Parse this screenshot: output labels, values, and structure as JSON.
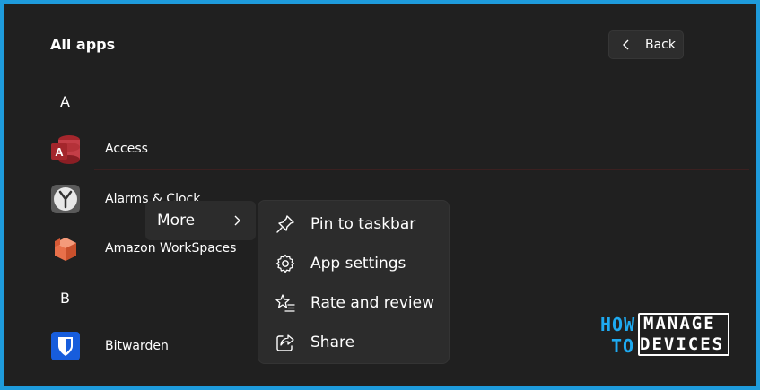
{
  "header": {
    "title": "All apps",
    "back_label": "Back"
  },
  "sections": [
    {
      "letter": "A",
      "apps": [
        {
          "name": "Access",
          "icon": "access-icon"
        },
        {
          "name": "Alarms & Clock",
          "icon": "alarms-clock-icon"
        },
        {
          "name": "Amazon WorkSpaces",
          "icon": "amazon-workspaces-icon"
        }
      ]
    },
    {
      "letter": "B",
      "apps": [
        {
          "name": "Bitwarden",
          "icon": "bitwarden-icon"
        }
      ]
    }
  ],
  "context": {
    "more_label": "More",
    "submenu": [
      {
        "label": "Pin to taskbar",
        "icon": "pin-icon"
      },
      {
        "label": "App settings",
        "icon": "gear-icon"
      },
      {
        "label": "Rate and review",
        "icon": "star-list-icon"
      },
      {
        "label": "Share",
        "icon": "share-icon"
      }
    ]
  },
  "watermark": {
    "line1a": "HOW",
    "line1b": "MANAGE",
    "line2a": "TO",
    "line2b": "DEVICES"
  },
  "colors": {
    "background": "#202020",
    "border": "#1e9bdc",
    "menu": "#2c2c2c",
    "brand_blue": "#1eaaf1"
  }
}
